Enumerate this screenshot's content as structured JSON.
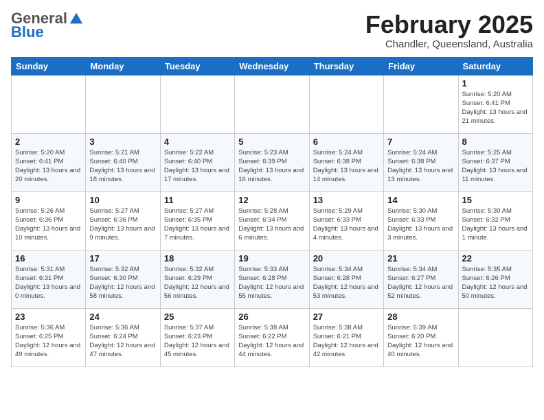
{
  "header": {
    "logo_general": "General",
    "logo_blue": "Blue",
    "month_title": "February 2025",
    "subtitle": "Chandler, Queensland, Australia"
  },
  "weekdays": [
    "Sunday",
    "Monday",
    "Tuesday",
    "Wednesday",
    "Thursday",
    "Friday",
    "Saturday"
  ],
  "weeks": [
    [
      {
        "day": "",
        "info": ""
      },
      {
        "day": "",
        "info": ""
      },
      {
        "day": "",
        "info": ""
      },
      {
        "day": "",
        "info": ""
      },
      {
        "day": "",
        "info": ""
      },
      {
        "day": "",
        "info": ""
      },
      {
        "day": "1",
        "info": "Sunrise: 5:20 AM\nSunset: 6:41 PM\nDaylight: 13 hours\nand 21 minutes."
      }
    ],
    [
      {
        "day": "2",
        "info": "Sunrise: 5:20 AM\nSunset: 6:41 PM\nDaylight: 13 hours\nand 20 minutes."
      },
      {
        "day": "3",
        "info": "Sunrise: 5:21 AM\nSunset: 6:40 PM\nDaylight: 13 hours\nand 18 minutes."
      },
      {
        "day": "4",
        "info": "Sunrise: 5:22 AM\nSunset: 6:40 PM\nDaylight: 13 hours\nand 17 minutes."
      },
      {
        "day": "5",
        "info": "Sunrise: 5:23 AM\nSunset: 6:39 PM\nDaylight: 13 hours\nand 16 minutes."
      },
      {
        "day": "6",
        "info": "Sunrise: 5:24 AM\nSunset: 6:38 PM\nDaylight: 13 hours\nand 14 minutes."
      },
      {
        "day": "7",
        "info": "Sunrise: 5:24 AM\nSunset: 6:38 PM\nDaylight: 13 hours\nand 13 minutes."
      },
      {
        "day": "8",
        "info": "Sunrise: 5:25 AM\nSunset: 6:37 PM\nDaylight: 13 hours\nand 11 minutes."
      }
    ],
    [
      {
        "day": "9",
        "info": "Sunrise: 5:26 AM\nSunset: 6:36 PM\nDaylight: 13 hours\nand 10 minutes."
      },
      {
        "day": "10",
        "info": "Sunrise: 5:27 AM\nSunset: 6:36 PM\nDaylight: 13 hours\nand 9 minutes."
      },
      {
        "day": "11",
        "info": "Sunrise: 5:27 AM\nSunset: 6:35 PM\nDaylight: 13 hours\nand 7 minutes."
      },
      {
        "day": "12",
        "info": "Sunrise: 5:28 AM\nSunset: 6:34 PM\nDaylight: 13 hours\nand 6 minutes."
      },
      {
        "day": "13",
        "info": "Sunrise: 5:29 AM\nSunset: 6:33 PM\nDaylight: 13 hours\nand 4 minutes."
      },
      {
        "day": "14",
        "info": "Sunrise: 5:30 AM\nSunset: 6:33 PM\nDaylight: 13 hours\nand 3 minutes."
      },
      {
        "day": "15",
        "info": "Sunrise: 5:30 AM\nSunset: 6:32 PM\nDaylight: 13 hours\nand 1 minute."
      }
    ],
    [
      {
        "day": "16",
        "info": "Sunrise: 5:31 AM\nSunset: 6:31 PM\nDaylight: 13 hours\nand 0 minutes."
      },
      {
        "day": "17",
        "info": "Sunrise: 5:32 AM\nSunset: 6:30 PM\nDaylight: 12 hours\nand 58 minutes."
      },
      {
        "day": "18",
        "info": "Sunrise: 5:32 AM\nSunset: 6:29 PM\nDaylight: 12 hours\nand 56 minutes."
      },
      {
        "day": "19",
        "info": "Sunrise: 5:33 AM\nSunset: 6:28 PM\nDaylight: 12 hours\nand 55 minutes."
      },
      {
        "day": "20",
        "info": "Sunrise: 5:34 AM\nSunset: 6:28 PM\nDaylight: 12 hours\nand 53 minutes."
      },
      {
        "day": "21",
        "info": "Sunrise: 5:34 AM\nSunset: 6:27 PM\nDaylight: 12 hours\nand 52 minutes."
      },
      {
        "day": "22",
        "info": "Sunrise: 5:35 AM\nSunset: 6:26 PM\nDaylight: 12 hours\nand 50 minutes."
      }
    ],
    [
      {
        "day": "23",
        "info": "Sunrise: 5:36 AM\nSunset: 6:25 PM\nDaylight: 12 hours\nand 49 minutes."
      },
      {
        "day": "24",
        "info": "Sunrise: 5:36 AM\nSunset: 6:24 PM\nDaylight: 12 hours\nand 47 minutes."
      },
      {
        "day": "25",
        "info": "Sunrise: 5:37 AM\nSunset: 6:23 PM\nDaylight: 12 hours\nand 45 minutes."
      },
      {
        "day": "26",
        "info": "Sunrise: 5:38 AM\nSunset: 6:22 PM\nDaylight: 12 hours\nand 44 minutes."
      },
      {
        "day": "27",
        "info": "Sunrise: 5:38 AM\nSunset: 6:21 PM\nDaylight: 12 hours\nand 42 minutes."
      },
      {
        "day": "28",
        "info": "Sunrise: 5:39 AM\nSunset: 6:20 PM\nDaylight: 12 hours\nand 40 minutes."
      },
      {
        "day": "",
        "info": ""
      }
    ]
  ]
}
